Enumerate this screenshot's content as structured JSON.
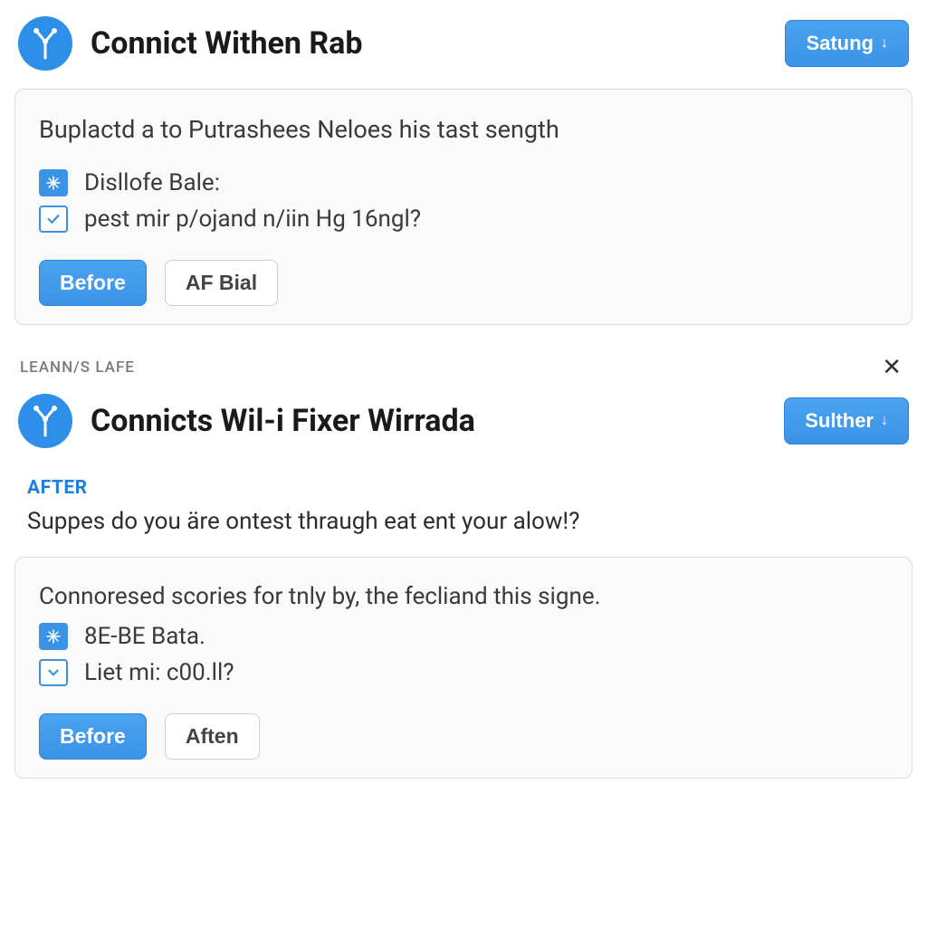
{
  "card1": {
    "title": "Connict Withen Rab",
    "cta": "Satung",
    "body": "Buplactd a to Putrashees Neloes his tast sength",
    "item1": "Disllofe Bale:",
    "item2": "pest mir p/ojand n/iin Hg 16ngl?",
    "btn_primary": "Before",
    "btn_secondary": "AF Bial"
  },
  "section_label": "LEANN/S LAFE",
  "card2": {
    "title": "Connicts Wil-i Fixer Wirrada",
    "cta": "Sulther",
    "after_label": "AFTER",
    "after_text": "Suppes do you äre ontest thraugh eat ent your alow!?",
    "body": "Connoresed scories for tnly by, the fecliand this signe.",
    "item1": "8E-BE Bata.",
    "item2": "Liet mi: c00.ll?",
    "btn_primary": "Before",
    "btn_secondary": "Aften"
  }
}
